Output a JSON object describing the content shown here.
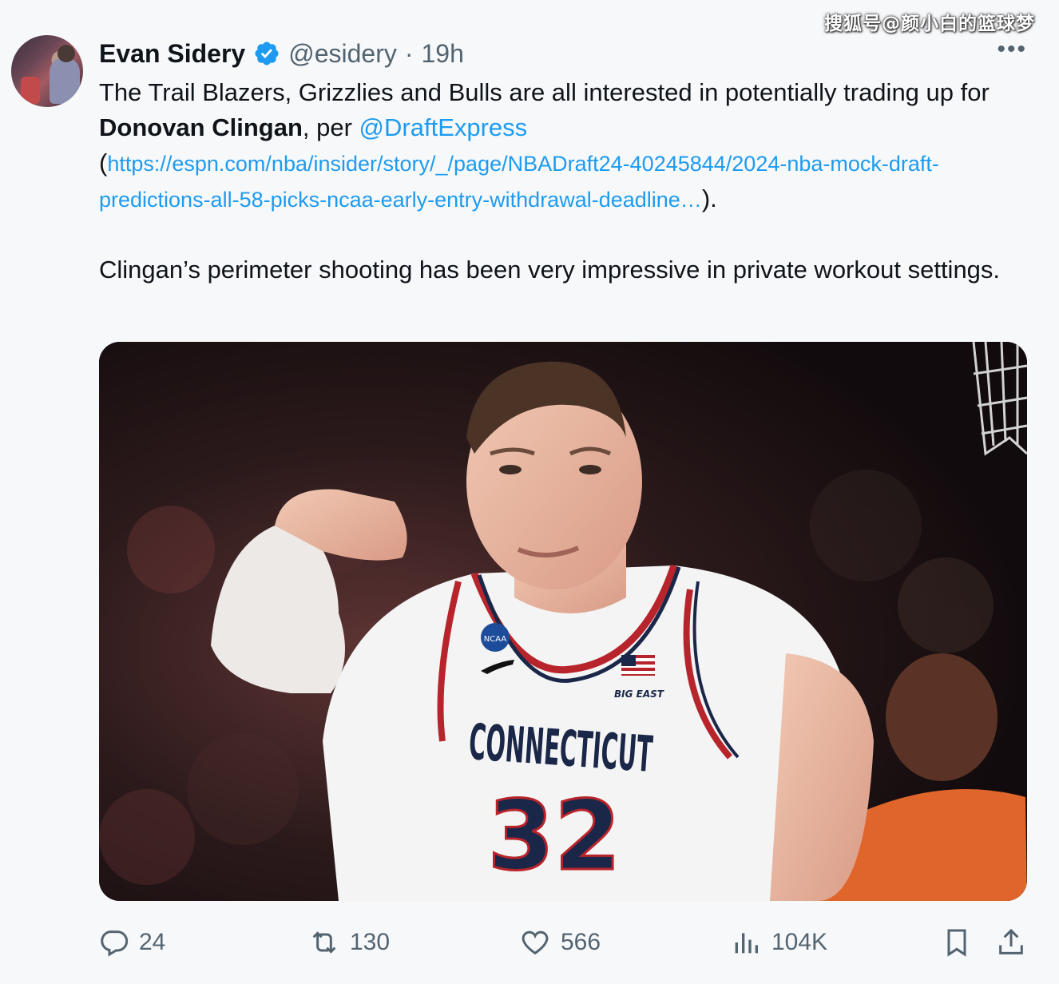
{
  "watermark": "搜狐号@颜小白的篮球梦",
  "author": {
    "name": "Evan Sidery",
    "handle": "@esidery",
    "separator": "·",
    "time": "19h"
  },
  "more_label": "•••",
  "tweet": {
    "p1_a": "The Trail Blazers, Grizzlies and Bulls are all interested in potentially trading up for ",
    "p1_bold": "Donovan Clingan",
    "p1_b": ", per ",
    "mention": "@DraftExpress",
    "paren_open": "(",
    "url": "https://espn.com/nba/insider/story/_/page/NBADraft24-40245844/2024-nba-mock-draft-predictions-all-58-picks-ncaa-early-entry-withdrawal-deadline…",
    "paren_close": ").",
    "p2": "Clingan’s perimeter shooting has been very impressive in private workout settings."
  },
  "media": {
    "jersey_text": "CONNECTICUT",
    "jersey_number": "32",
    "patch_text": "NCAA",
    "side_patch": "BIG EAST"
  },
  "actions": {
    "replies": "24",
    "reposts": "130",
    "likes": "566",
    "views": "104K"
  },
  "colors": {
    "link": "#1d9bf0",
    "secondary_text": "#536471",
    "verified": "#1d9bf0"
  }
}
